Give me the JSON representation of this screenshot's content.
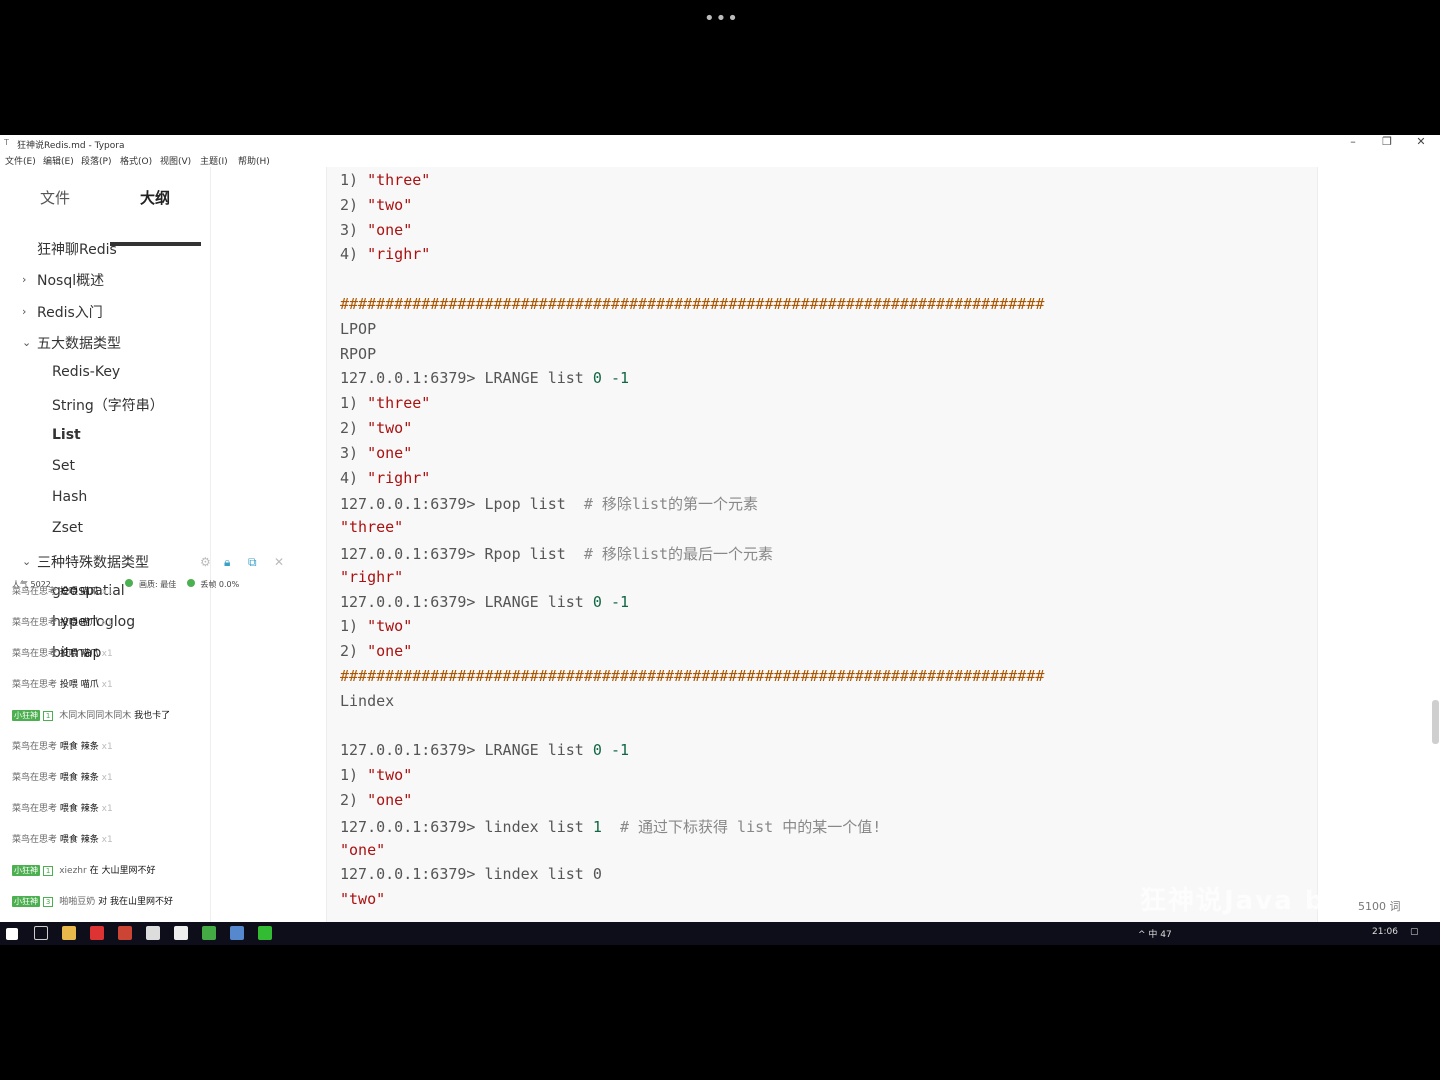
{
  "player": {
    "menu_dots": "•••"
  },
  "window": {
    "title": "狂神说Redis.md - Typora",
    "app_icon": "T",
    "controls": {
      "minimize": "–",
      "restore": "❐",
      "close": "✕"
    }
  },
  "menu": [
    "文件(E)",
    "编辑(E)",
    "段落(P)",
    "格式(O)",
    "视图(V)",
    "主题(I)",
    "帮助(H)"
  ],
  "sidebar": {
    "tabs": {
      "files": "文件",
      "outline": "大纲"
    },
    "outline": [
      {
        "label": "狂神聊Redis",
        "level": 0,
        "chevron": ""
      },
      {
        "label": "Nosql概述",
        "level": 0,
        "chevron": "›"
      },
      {
        "label": "Redis入门",
        "level": 0,
        "chevron": "›"
      },
      {
        "label": "五大数据类型",
        "level": 0,
        "chevron": "⌄"
      },
      {
        "label": "Redis-Key",
        "level": 1,
        "chevron": ""
      },
      {
        "label": "String（字符串）",
        "level": 1,
        "chevron": ""
      },
      {
        "label": "List",
        "level": 1,
        "chevron": "",
        "active": true
      },
      {
        "label": "Set",
        "level": 1,
        "chevron": ""
      },
      {
        "label": "Hash",
        "level": 1,
        "chevron": ""
      },
      {
        "label": "Zset",
        "level": 1,
        "chevron": ""
      },
      {
        "label": "三种特殊数据类型",
        "level": 0,
        "chevron": "⌄"
      },
      {
        "label": "geospatial",
        "level": 1,
        "chevron": ""
      },
      {
        "label": "hyperloglog",
        "level": 1,
        "chevron": ""
      },
      {
        "label": "bitmap",
        "level": 1,
        "chevron": ""
      }
    ],
    "footer": {
      "back": "‹",
      "source_mode": "</>"
    }
  },
  "live_overlay": {
    "stats": {
      "popularity": "人气 5022",
      "quality": "画质: 最佳",
      "drop": "丢帧 0.0%"
    },
    "danmaku": [
      {
        "user": "菜鸟在思考",
        "action": "投喂",
        "gift": "喵爪",
        "count": "x1"
      },
      {
        "user": "菜鸟在思考",
        "action": "投喂",
        "gift": "喵爪",
        "count": "x1"
      },
      {
        "user": "菜鸟在思考",
        "action": "投喂",
        "gift": "喵爪",
        "count": "x1"
      },
      {
        "user": "菜鸟在思考",
        "action": "投喂",
        "gift": "喵爪",
        "count": "x1"
      },
      {
        "badge": "小狂神",
        "level": "1",
        "user": "木同木同同木同木",
        "message": "我也卡了"
      },
      {
        "user": "菜鸟在思考",
        "action": "喂食",
        "gift": "辣条",
        "count": "x1"
      },
      {
        "user": "菜鸟在思考",
        "action": "喂食",
        "gift": "辣条",
        "count": "x1"
      },
      {
        "user": "菜鸟在思考",
        "action": "喂食",
        "gift": "辣条",
        "count": "x1"
      },
      {
        "user": "菜鸟在思考",
        "action": "喂食",
        "gift": "辣条",
        "count": "x1"
      },
      {
        "badge": "小狂神",
        "level": "1",
        "user": "xiezhr",
        "message": "在 大山里网不好"
      },
      {
        "badge": "小狂神",
        "level": "3",
        "user": "啪啪豆奶",
        "message": "对 我在山里网不好"
      }
    ]
  },
  "code": [
    [
      [
        "1) ",
        "kw"
      ],
      [
        "\"three\"",
        "str"
      ]
    ],
    [
      [
        "2) ",
        "kw"
      ],
      [
        "\"two\"",
        "str"
      ]
    ],
    [
      [
        "3) ",
        "kw"
      ],
      [
        "\"one\"",
        "str"
      ]
    ],
    [
      [
        "4) ",
        "kw"
      ],
      [
        "\"righr\"",
        "str"
      ]
    ],
    [],
    [
      [
        "##############################################################################",
        "hash"
      ]
    ],
    [
      [
        "LPOP",
        "kw"
      ]
    ],
    [
      [
        "RPOP",
        "kw"
      ]
    ],
    [
      [
        "127.0.0.1:6379> LRANGE ",
        "kw"
      ],
      [
        "list",
        "kw"
      ],
      [
        " 0 ",
        "num"
      ],
      [
        "-1",
        "num"
      ]
    ],
    [
      [
        "1) ",
        "kw"
      ],
      [
        "\"three\"",
        "str"
      ]
    ],
    [
      [
        "2) ",
        "kw"
      ],
      [
        "\"two\"",
        "str"
      ]
    ],
    [
      [
        "3) ",
        "kw"
      ],
      [
        "\"one\"",
        "str"
      ]
    ],
    [
      [
        "4) ",
        "kw"
      ],
      [
        "\"righr\"",
        "str"
      ]
    ],
    [
      [
        "127.0.0.1:6379> Lpop list  ",
        "kw"
      ],
      [
        "# 移除list的第一个元素",
        "cmt"
      ]
    ],
    [
      [
        "\"three\"",
        "str"
      ]
    ],
    [
      [
        "127.0.0.1:6379> Rpop list  ",
        "kw"
      ],
      [
        "# 移除list的最后一个元素",
        "cmt"
      ]
    ],
    [
      [
        "\"righr\"",
        "str"
      ]
    ],
    [
      [
        "127.0.0.1:6379> LRANGE ",
        "kw"
      ],
      [
        "list",
        "kw"
      ],
      [
        " 0 ",
        "num"
      ],
      [
        "-1",
        "num"
      ]
    ],
    [
      [
        "1) ",
        "kw"
      ],
      [
        "\"two\"",
        "str"
      ]
    ],
    [
      [
        "2) ",
        "kw"
      ],
      [
        "\"one\"",
        "str"
      ]
    ],
    [
      [
        "##############################################################################",
        "hash"
      ]
    ],
    [
      [
        "Lindex",
        "kw"
      ]
    ],
    [],
    [
      [
        "127.0.0.1:6379> LRANGE ",
        "kw"
      ],
      [
        "list",
        "kw"
      ],
      [
        " 0 ",
        "num"
      ],
      [
        "-1",
        "num"
      ]
    ],
    [
      [
        "1) ",
        "kw"
      ],
      [
        "\"two\"",
        "str"
      ]
    ],
    [
      [
        "2) ",
        "kw"
      ],
      [
        "\"one\"",
        "str"
      ]
    ],
    [
      [
        "127.0.0.1:6379> lindex list ",
        "kw"
      ],
      [
        "1",
        "num"
      ],
      [
        "  # 通过下标获得 list 中的某一个值!",
        "cmt"
      ]
    ],
    [
      [
        "\"one\"",
        "str"
      ]
    ],
    [
      [
        "127.0.0.1:6379> lindex list 0",
        "kw"
      ]
    ],
    [
      [
        "\"two\"",
        "str"
      ]
    ]
  ],
  "status": {
    "word_count": "5100 词"
  },
  "watermark": "狂神说Java bilibili",
  "taskbar": {
    "tray_text": "^ 中 47",
    "clock": "21:06"
  }
}
